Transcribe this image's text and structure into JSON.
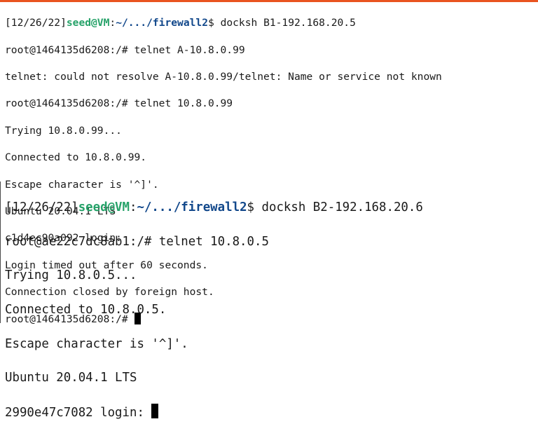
{
  "colors": {
    "user": "#26a269",
    "path": "#12488b",
    "text": "#1a1a1a",
    "accent_bar": "#e95420"
  },
  "terminal1": {
    "prompt": {
      "date": "[12/26/22]",
      "user": "seed@VM",
      "sep": ":",
      "path": "~/.../firewall2",
      "symbol": "$ ",
      "command": "docksh B1-192.168.20.5"
    },
    "lines": [
      "root@1464135d6208:/# telnet A-10.8.0.99",
      "telnet: could not resolve A-10.8.0.99/telnet: Name or service not known",
      "root@1464135d6208:/# telnet 10.8.0.99",
      "Trying 10.8.0.99...",
      "Connected to 10.8.0.99.",
      "Escape character is '^]'.",
      "Ubuntu 20.04.1 LTS",
      "c1d4ec90a092 login:",
      "Login timed out after 60 seconds.",
      "Connection closed by foreign host.",
      "root@1464135d6208:/# "
    ]
  },
  "terminal2": {
    "prompt": {
      "date": "[12/26/22]",
      "user": "seed@VM",
      "sep": ":",
      "path": "~/.../firewall2",
      "symbol": "$ ",
      "command": "docksh B2-192.168.20.6"
    },
    "lines": [
      "root@ae22c7dc8ab1:/# telnet 10.8.0.5",
      "Trying 10.8.0.5...",
      "Connected to 10.8.0.5.",
      "Escape character is '^]'.",
      "Ubuntu 20.04.1 LTS",
      "2990e47c7082 login: "
    ]
  }
}
